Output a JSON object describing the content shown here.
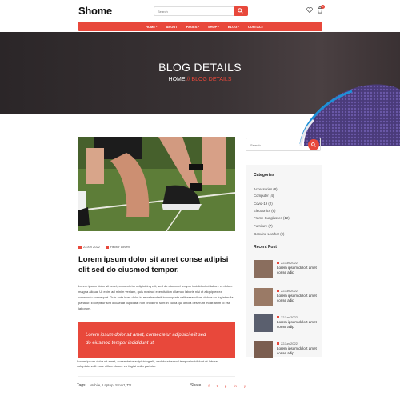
{
  "brand": {
    "logo": "Shome",
    "accent": "#e8483b"
  },
  "header": {
    "search_placeholder": "Search",
    "cart_count": "0",
    "nav": [
      {
        "label": "HOME",
        "caret": true
      },
      {
        "label": "ABOUT",
        "caret": false
      },
      {
        "label": "PAGES",
        "caret": true
      },
      {
        "label": "SHOP",
        "caret": true
      },
      {
        "label": "BLOG",
        "caret": true
      },
      {
        "label": "CONTACT",
        "caret": false
      }
    ]
  },
  "hero": {
    "title": "BLOG DETAILS",
    "breadcrumb_home": "HOME",
    "breadcrumb_sep": "//",
    "breadcrumb_current": "BLOG DETAILS"
  },
  "post": {
    "date": "22Jun 2022",
    "author": "Hector Lovett",
    "title_line1": "Lorem ipsum dolor sit amet conse adipisi",
    "title_line2": "elit sed do eiusmod tempor.",
    "paragraph": "Lorem ipsum dolor sit amet, consectetur adipisicing elit, sed do eiusmod tempor incididunt ut labore et dolore magna aliqua. Ut enim ad minim veniam, quis nostrud exercitation ullamco laboris nisi ut aliquip ex ea commodo consequat. Duis aute irure dolor in reprehenderit in voluptate velit esse cillum dolore eu fugiat nulla pariatur. Excepteur sint occaecat cupidatat non proident, sunt in culpa qui officia deserunt mollit anim id est laborum.",
    "quote_line1": "Lorem ipsum dolor sit amet, consectetur adipisici elit sed",
    "quote_line2": "do eiusmod tempor incididunt ut",
    "paragraph2_line1": "Lorem ipsum dolor sit amet, consectetur adipisicing elit, sed do eiusmod tempor incididunt ut labore",
    "paragraph2_line2": "voluptate velit esse cillum dolore eu fugiat nulla pariatur.",
    "tags_label": "Tags:",
    "tags": "Mobile, Laptop, Smart, TV",
    "share_label": "Share",
    "share_icons": [
      "f",
      "t",
      "p",
      "in",
      "y"
    ]
  },
  "sidebar": {
    "search_placeholder": "Search",
    "categories_title": "Categories",
    "categories": [
      "Accessories (8)",
      "Computer (4)",
      "Covid-19 (2)",
      "Electronics (6)",
      "Frame Sunglasses (12)",
      "Furniture (7)",
      "Genuine Leather (9)"
    ],
    "recent_title": "Recent Post",
    "recent_posts": [
      {
        "date": "22Jun 2022",
        "title": "Lorem ipsum dolort amet conse adip"
      },
      {
        "date": "22Jun 2022",
        "title": "Lorem ipsum dolort amet conse adip"
      },
      {
        "date": "22Jun 2022",
        "title": "Lorem ipsum dolort amet conse adip"
      },
      {
        "date": "22Jun 2022",
        "title": "Lorem ipsum dolort amet conse adip"
      }
    ]
  }
}
